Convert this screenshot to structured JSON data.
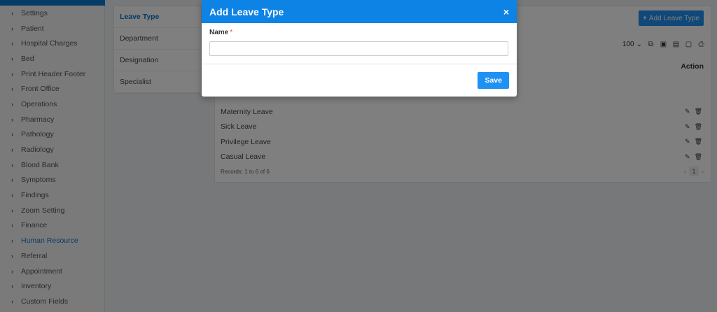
{
  "sidebar": {
    "items": [
      {
        "label": "Settings"
      },
      {
        "label": "Patient"
      },
      {
        "label": "Hospital Charges"
      },
      {
        "label": "Bed"
      },
      {
        "label": "Print Header Footer"
      },
      {
        "label": "Front Office"
      },
      {
        "label": "Operations"
      },
      {
        "label": "Pharmacy"
      },
      {
        "label": "Pathology"
      },
      {
        "label": "Radiology"
      },
      {
        "label": "Blood Bank"
      },
      {
        "label": "Symptoms"
      },
      {
        "label": "Findings"
      },
      {
        "label": "Zoom Setting"
      },
      {
        "label": "Finance"
      },
      {
        "label": "Human Resource",
        "active": true
      },
      {
        "label": "Referral"
      },
      {
        "label": "Appointment"
      },
      {
        "label": "Inventory"
      },
      {
        "label": "Custom Fields"
      }
    ]
  },
  "submenu": {
    "items": [
      "Leave Type",
      "Department",
      "Designation",
      "Specialist"
    ]
  },
  "panel": {
    "add_button": "Add Leave Type",
    "page_size": "100",
    "action_header": "Action",
    "rows": [
      "Maternity Leave",
      "Sick Leave",
      "Privilege Leave",
      "Casual Leave"
    ],
    "records": "Records: 1 to 6 of 6",
    "current_page": "1"
  },
  "modal": {
    "title": "Add Leave Type",
    "close": "×",
    "name_label": "Name",
    "required_mark": "*",
    "name_value": "",
    "save": "Save"
  },
  "colors": {
    "accent": "#0d83e6",
    "button": "#1f91f3",
    "active_nav": "#0d78d1"
  }
}
